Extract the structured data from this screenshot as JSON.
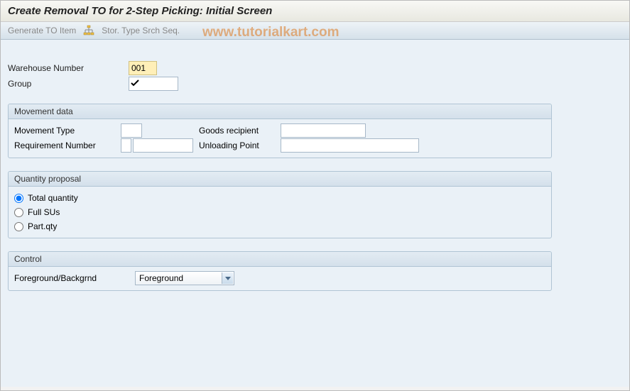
{
  "title": "Create Removal TO for 2-Step Picking: Initial Screen",
  "toolbar": {
    "generate_label": "Generate TO Item",
    "srch_label": "Stor. Type Srch Seq."
  },
  "watermark": "www.tutorialkart.com",
  "fields": {
    "warehouse_label": "Warehouse Number",
    "warehouse_value": "001",
    "group_label": "Group",
    "group_value": ""
  },
  "movement": {
    "header": "Movement data",
    "movement_type_label": "Movement Type",
    "movement_type_value": "",
    "goods_recipient_label": "Goods recipient",
    "goods_recipient_value": "",
    "requirement_label": "Requirement Number",
    "requirement_value1": "",
    "requirement_value2": "",
    "unloading_label": "Unloading Point",
    "unloading_value": ""
  },
  "quantity": {
    "header": "Quantity proposal",
    "total_label": "Total quantity",
    "full_label": "Full SUs",
    "part_label": "Part.qty"
  },
  "control": {
    "header": "Control",
    "fgbg_label": "Foreground/Backgrnd",
    "fgbg_value": "Foreground"
  }
}
